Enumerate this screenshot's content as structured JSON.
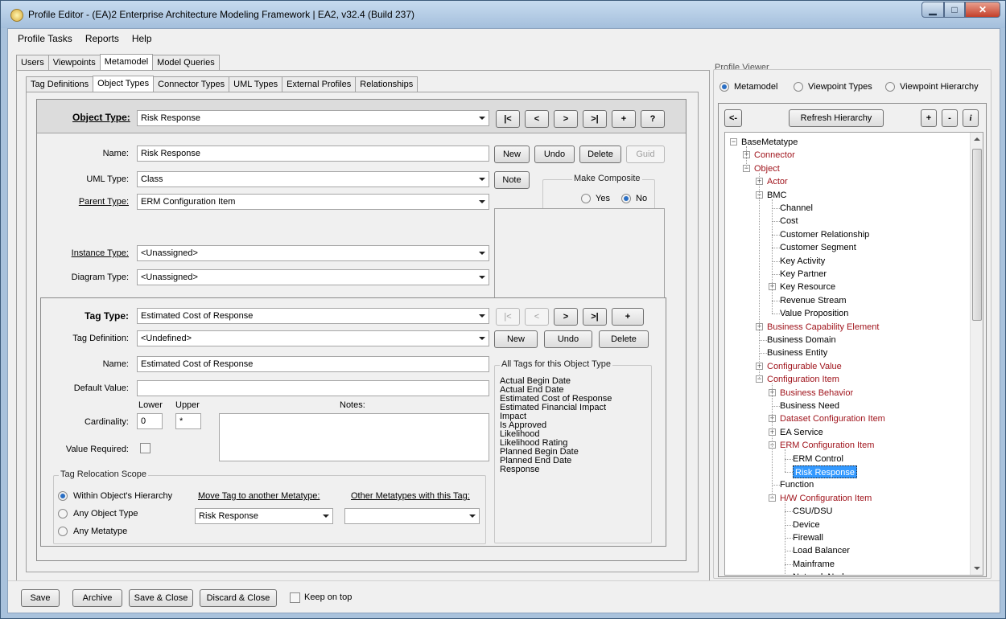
{
  "window": {
    "title": "Profile Editor - (EA)2 Enterprise Architecture Modeling Framework | EA2, v32.4 (Build 237)"
  },
  "menu": [
    "Profile Tasks",
    "Reports",
    "Help"
  ],
  "main_tabs": [
    "Users",
    "Viewpoints",
    "Metamodel",
    "Model Queries"
  ],
  "sub_tabs": [
    "Tag Definitions",
    "Object Types",
    "Connector Types",
    "UML Types",
    "External Profiles",
    "Relationships"
  ],
  "object_type": {
    "label": "Object Type:",
    "value": "Risk Response",
    "nav": {
      "first": "|<",
      "prev": "<",
      "next": ">",
      "last": ">|",
      "add": "+",
      "help": "?"
    },
    "name_label": "Name:",
    "name_value": "Risk Response",
    "new": "New",
    "undo": "Undo",
    "delete": "Delete",
    "guid": "Guid",
    "uml_type_label": "UML Type:",
    "uml_type_value": "Class",
    "note": "Note",
    "make_composite_label": "Make Composite",
    "yes": "Yes",
    "no": "No",
    "parent_type_label": "Parent Type:",
    "parent_type_value": "ERM Configuration Item",
    "instance_type_label": "Instance Type:",
    "instance_type_value": "<Unassigned>",
    "diagram_type_label": "Diagram Type:",
    "diagram_type_value": "<Unassigned>"
  },
  "tag_type": {
    "label": "Tag Type:",
    "value": "Estimated Cost of Response",
    "nav": {
      "first": "|<",
      "prev": "<",
      "next": ">",
      "last": ">|",
      "add": "+"
    },
    "tag_definition_label": "Tag Definition:",
    "tag_definition_value": "<Undefined>",
    "new": "New",
    "undo": "Undo",
    "delete": "Delete",
    "name_label": "Name:",
    "name_value": "Estimated Cost of Response",
    "default_value_label": "Default Value:",
    "default_value": "",
    "lower_label": "Lower",
    "upper_label": "Upper",
    "notes_label": "Notes:",
    "cardinality_label": "Cardinality:",
    "lower_value": "0",
    "upper_value": "*",
    "value_required_label": "Value Required:",
    "all_tags_label": "All Tags for this Object Type",
    "all_tags": [
      "Actual Begin Date",
      "Actual End Date",
      "Estimated Cost of Response",
      "Estimated Financial Impact",
      "Impact",
      "Is Approved",
      "Likelihood",
      "Likelihood Rating",
      "Planned Begin Date",
      "Planned End Date",
      "Response"
    ]
  },
  "relocation": {
    "label": "Tag Relocation Scope",
    "options": [
      "Within Object's Hierarchy",
      "Any Object Type",
      "Any Metatype"
    ],
    "move_label": "Move Tag to another Metatype:",
    "move_value": "Risk Response",
    "other_label": "Other Metatypes with this Tag:",
    "other_value": ""
  },
  "bottom": {
    "save": "Save",
    "archive": "Archive",
    "save_close": "Save & Close",
    "discard_close": "Discard & Close",
    "keep_on_top": "Keep on top"
  },
  "viewer": {
    "label": "Profile Viewer",
    "options": [
      "Metamodel",
      "Viewpoint Types",
      "Viewpoint Hierarchy"
    ],
    "back": "<-",
    "refresh": "Refresh Hierarchy",
    "plus": "+",
    "minus": "-",
    "info": "i"
  },
  "tree": [
    {
      "t": "BaseMetatype",
      "d": 0,
      "pm": "-",
      "red": false
    },
    {
      "t": "Connector",
      "d": 1,
      "pm": "+",
      "red": true
    },
    {
      "t": "Object",
      "d": 1,
      "pm": "-",
      "red": true
    },
    {
      "t": "Actor",
      "d": 2,
      "pm": "+",
      "red": true
    },
    {
      "t": "BMC",
      "d": 2,
      "pm": "-",
      "red": false
    },
    {
      "t": "Channel",
      "d": 3,
      "pm": "",
      "red": false
    },
    {
      "t": "Cost",
      "d": 3,
      "pm": "",
      "red": false
    },
    {
      "t": "Customer Relationship",
      "d": 3,
      "pm": "",
      "red": false
    },
    {
      "t": "Customer Segment",
      "d": 3,
      "pm": "",
      "red": false
    },
    {
      "t": "Key Activity",
      "d": 3,
      "pm": "",
      "red": false
    },
    {
      "t": "Key Partner",
      "d": 3,
      "pm": "",
      "red": false
    },
    {
      "t": "Key Resource",
      "d": 3,
      "pm": "+",
      "red": false
    },
    {
      "t": "Revenue Stream",
      "d": 3,
      "pm": "",
      "red": false
    },
    {
      "t": "Value Proposition",
      "d": 3,
      "pm": "",
      "red": false
    },
    {
      "t": "Business Capability Element",
      "d": 2,
      "pm": "+",
      "red": true
    },
    {
      "t": "Business Domain",
      "d": 2,
      "pm": "",
      "red": false
    },
    {
      "t": "Business Entity",
      "d": 2,
      "pm": "",
      "red": false
    },
    {
      "t": "Configurable Value",
      "d": 2,
      "pm": "+",
      "red": true
    },
    {
      "t": "Configuration Item",
      "d": 2,
      "pm": "-",
      "red": true
    },
    {
      "t": "Business Behavior",
      "d": 3,
      "pm": "+",
      "red": true
    },
    {
      "t": "Business Need",
      "d": 3,
      "pm": "",
      "red": false
    },
    {
      "t": "Dataset Configuration Item",
      "d": 3,
      "pm": "+",
      "red": true
    },
    {
      "t": "EA Service",
      "d": 3,
      "pm": "+",
      "red": false
    },
    {
      "t": "ERM Configuration Item",
      "d": 3,
      "pm": "-",
      "red": true
    },
    {
      "t": "ERM Control",
      "d": 4,
      "pm": "",
      "red": false
    },
    {
      "t": "Risk Response",
      "d": 4,
      "pm": "",
      "red": false,
      "sel": true
    },
    {
      "t": "Function",
      "d": 3,
      "pm": "",
      "red": false
    },
    {
      "t": "H/W Configuration Item",
      "d": 3,
      "pm": "-",
      "red": true
    },
    {
      "t": "CSU/DSU",
      "d": 4,
      "pm": "",
      "red": false
    },
    {
      "t": "Device",
      "d": 4,
      "pm": "",
      "red": false
    },
    {
      "t": "Firewall",
      "d": 4,
      "pm": "",
      "red": false
    },
    {
      "t": "Load Balancer",
      "d": 4,
      "pm": "",
      "red": false
    },
    {
      "t": "Mainframe",
      "d": 4,
      "pm": "",
      "red": false
    },
    {
      "t": "Network Node",
      "d": 4,
      "pm": "",
      "red": false
    }
  ]
}
